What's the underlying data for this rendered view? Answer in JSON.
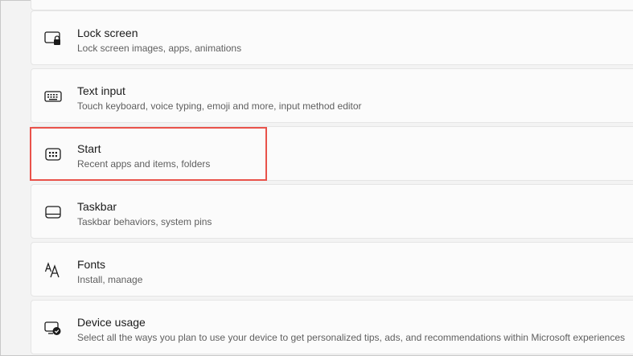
{
  "settings": {
    "items": [
      {
        "title": "Lock screen",
        "subtitle": "Lock screen images, apps, animations",
        "icon": "lock-screen-icon"
      },
      {
        "title": "Text input",
        "subtitle": "Touch keyboard, voice typing, emoji and more, input method editor",
        "icon": "keyboard-icon"
      },
      {
        "title": "Start",
        "subtitle": "Recent apps and items, folders",
        "icon": "start-menu-icon"
      },
      {
        "title": "Taskbar",
        "subtitle": "Taskbar behaviors, system pins",
        "icon": "taskbar-icon"
      },
      {
        "title": "Fonts",
        "subtitle": "Install, manage",
        "icon": "fonts-icon"
      },
      {
        "title": "Device usage",
        "subtitle": "Select all the ways you plan to use your device to get personalized tips, ads, and recommendations within Microsoft experiences",
        "icon": "device-usage-icon"
      }
    ]
  },
  "colors": {
    "background": "#f3f3f3",
    "card": "#fbfbfb",
    "highlight": "#e9524a"
  }
}
